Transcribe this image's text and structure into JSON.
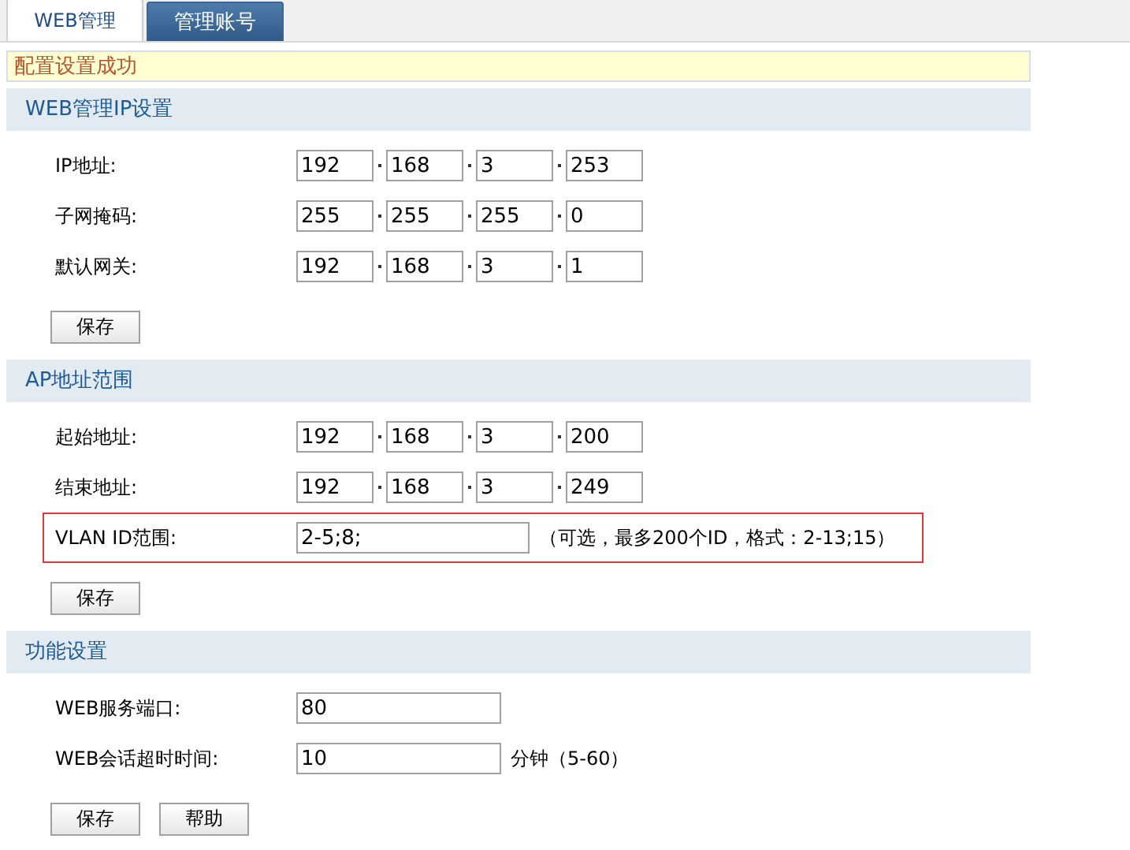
{
  "tabs": [
    {
      "label": "WEB管理",
      "selected": true
    },
    {
      "label": "管理账号",
      "selected": false
    }
  ],
  "notice": "配置设置成功",
  "sections": [
    {
      "title": "WEB管理IP设置",
      "rows": [
        {
          "kind": "ip",
          "label": "IP地址:",
          "octets": [
            "192",
            "168",
            "3",
            "253"
          ]
        },
        {
          "kind": "ip",
          "label": "子网掩码:",
          "octets": [
            "255",
            "255",
            "255",
            "0"
          ]
        },
        {
          "kind": "ip",
          "label": "默认网关:",
          "octets": [
            "192",
            "168",
            "3",
            "1"
          ]
        }
      ],
      "buttons": [
        "保存"
      ]
    },
    {
      "title": "AP地址范围",
      "rows": [
        {
          "kind": "ip",
          "label": "起始地址:",
          "octets": [
            "192",
            "168",
            "3",
            "200"
          ]
        },
        {
          "kind": "ip",
          "label": "结束地址:",
          "octets": [
            "192",
            "168",
            "3",
            "249"
          ]
        },
        {
          "kind": "range",
          "label": "VLAN ID范围:",
          "value": "2-5;8;",
          "hint": "（可选，最多200个ID，格式：2-13;15）",
          "highlighted": true
        }
      ],
      "buttons": [
        "保存"
      ]
    },
    {
      "title": "功能设置",
      "rows": [
        {
          "kind": "text",
          "label": "WEB服务端口:",
          "value": "80",
          "highlighted": false
        },
        {
          "kind": "text",
          "label": "WEB会话超时时间:",
          "value": "10",
          "hint": "分钟（5-60）",
          "highlighted": false
        }
      ],
      "buttons": [
        "保存",
        "帮助"
      ]
    }
  ]
}
